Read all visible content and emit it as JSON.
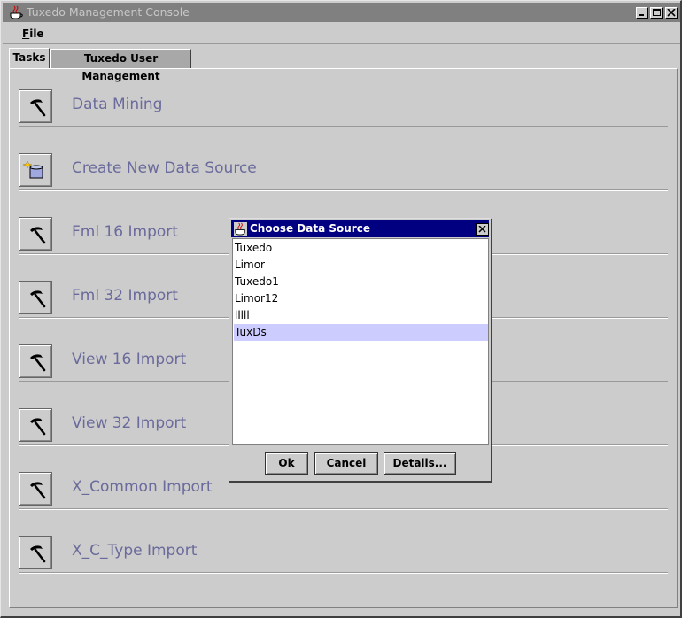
{
  "window": {
    "title": "Tuxedo Management Console",
    "title_icon": "java-coffee-icon",
    "controls": [
      "minimize-icon",
      "maximize-icon",
      "close-icon"
    ]
  },
  "menu": {
    "file_mnemonic": "F",
    "file_rest": "ile"
  },
  "tabs": [
    {
      "label": "Tasks",
      "selected": true
    },
    {
      "label": "Tuxedo User Management",
      "selected": false
    }
  ],
  "tasks": [
    {
      "label": "Data Mining",
      "icon": "pickaxe-icon"
    },
    {
      "label": "Create New Data Source",
      "icon": "new-database-icon"
    },
    {
      "label": "Fml 16 Import",
      "icon": "pickaxe-icon"
    },
    {
      "label": "Fml 32 Import",
      "icon": "pickaxe-icon"
    },
    {
      "label": "View 16 Import",
      "icon": "pickaxe-icon"
    },
    {
      "label": "View 32 Import",
      "icon": "pickaxe-icon"
    },
    {
      "label": "X_Common Import",
      "icon": "pickaxe-icon"
    },
    {
      "label": "X_C_Type Import",
      "icon": "pickaxe-icon"
    }
  ],
  "dialog": {
    "title": "Choose Data Source",
    "items": [
      "Tuxedo",
      "Limor",
      "Tuxedo1",
      "Limor12",
      "lllll",
      "TuxDs"
    ],
    "selected_index": 5,
    "buttons": {
      "ok": "Ok",
      "cancel": "Cancel",
      "details": "Details..."
    }
  },
  "colors": {
    "task_label": "#6a6a9c",
    "dialog_title_bg": "#000080",
    "selection": "#ccccff"
  }
}
